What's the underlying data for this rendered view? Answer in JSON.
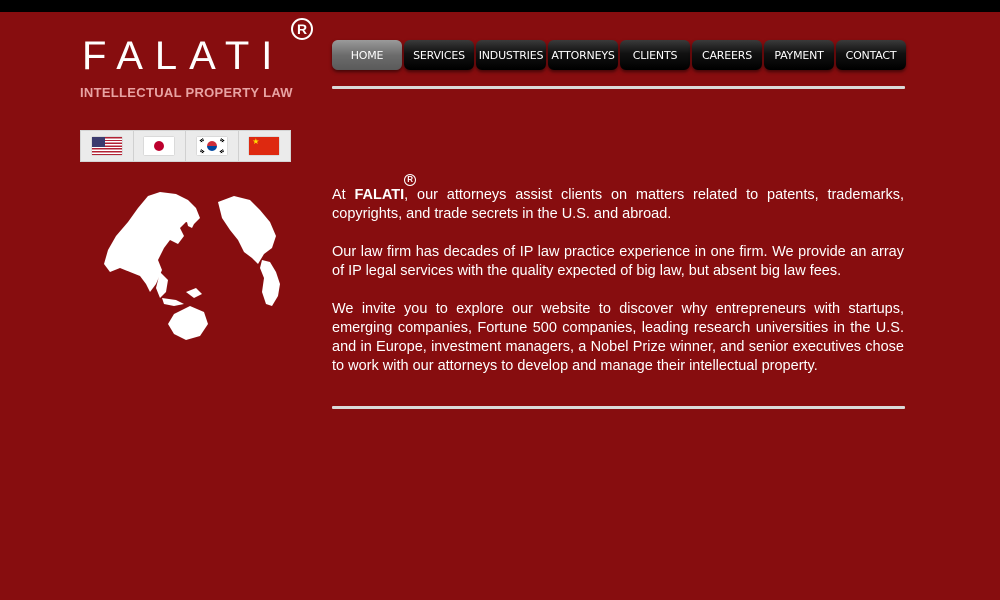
{
  "logo": {
    "name": "FALATI",
    "registered_mark": "R",
    "tagline": "INTELLECTUAL PROPERTY LAW"
  },
  "languages": [
    {
      "flag": "us-flag-icon"
    },
    {
      "flag": "japan-flag-icon"
    },
    {
      "flag": "korea-flag-icon"
    },
    {
      "flag": "china-flag-icon"
    }
  ],
  "nav": {
    "items": [
      "HOME",
      "SERVICES",
      "INDUSTRIES",
      "ATTORNEYS",
      "CLIENTS",
      "CAREERS",
      "PAYMENT",
      "CONTACT"
    ],
    "active": "HOME"
  },
  "content": {
    "p1_prefix": "At ",
    "p1_brand": "FALATI",
    "p1_reg": "R",
    "p1_rest": ", our attorneys assist clients on matters related to patents, trademarks, copyrights, and trade secrets in the U.S. and abroad.",
    "p2": "Our law firm has decades of IP law practice experience in one firm.  We provide an array of IP legal services with the quality expected of big law, but absent big law fees.",
    "p3": "We invite you to explore our website to discover why entrepreneurs with startups, emerging companies, Fortune 500 companies, leading research universities in the U.S. and in Europe, investment managers, a Nobel Prize winner, and senior executives chose to work with our attorneys to develop and manage their intellectual property."
  },
  "colors": {
    "background": "#870d0f",
    "topbar": "#000000",
    "tagline": "#e8a3a3",
    "nav_active": "#6c6c6c"
  }
}
